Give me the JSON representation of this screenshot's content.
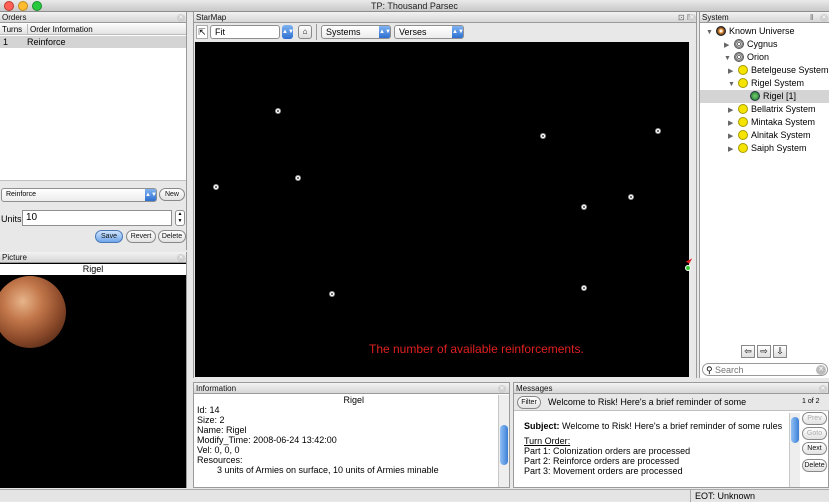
{
  "window": {
    "title": "TP: Thousand Parsec"
  },
  "orders": {
    "panel_title": "Orders",
    "columns": [
      "Turns",
      "Order Information"
    ],
    "rows": [
      {
        "turns": "1",
        "info": "Reinforce"
      }
    ],
    "order_type_selected": "Reinforce",
    "new_label": "New",
    "units_label": "Units",
    "units_value": "10",
    "save_label": "Save",
    "revert_label": "Revert",
    "delete_label": "Delete"
  },
  "picture": {
    "panel_title": "Picture",
    "caption": "Rigel"
  },
  "starmap": {
    "panel_title": "StarMap",
    "zoom_value": "Fit",
    "mode_value": "Systems",
    "overlay_value": "Verses",
    "annotation": "The number of available reinforcements."
  },
  "system": {
    "panel_title": "System",
    "tree": [
      {
        "label": "Known Universe",
        "icon": "universe-icon"
      },
      {
        "label": "Cygnus",
        "icon": "galaxy-icon"
      },
      {
        "label": "Orion",
        "icon": "galaxy-icon"
      },
      {
        "label": "Betelgeuse System",
        "icon": "sun-icon"
      },
      {
        "label": "Rigel System",
        "icon": "sun-icon"
      },
      {
        "label": "Rigel  [1]",
        "icon": "planet-icon"
      },
      {
        "label": "Bellatrix System",
        "icon": "sun-icon"
      },
      {
        "label": "Mintaka System",
        "icon": "sun-icon"
      },
      {
        "label": "Alnitak System",
        "icon": "sun-icon"
      },
      {
        "label": "Saiph System",
        "icon": "sun-icon"
      }
    ],
    "search_placeholder": "Search"
  },
  "information": {
    "panel_title": "Information",
    "heading": "Rigel",
    "lines": [
      "Id: 14",
      "Size: 2",
      "Name: Rigel",
      "Modify_Time: 2008-06-24 13:42:00",
      "Vel: 0, 0, 0",
      "Resources:"
    ],
    "resource_line": "3 units of Armies on surface, 10 units of Armies minable"
  },
  "messages": {
    "panel_title": "Messages",
    "filter_label": "Filter",
    "headline": "Welcome to Risk! Here's a brief reminder of some",
    "counter": "1 of 2",
    "subject_label": "Subject:",
    "subject_text": " Welcome to Risk! Here's a brief reminder of some rules",
    "turn_order_label": "Turn Order",
    "parts": [
      "Part 1: Colonization orders are processed",
      "Part 2: Reinforce orders are processed",
      "Part 3: Movement orders are processed"
    ],
    "prev_label": "Prev",
    "goto_label": "Goto",
    "next_label": "Next",
    "delete_label": "Delete"
  },
  "statusbar": {
    "text": "EOT: Unknown"
  },
  "colors": {
    "accent": "#3d7fd6",
    "annotation": "#e02020",
    "map_bg": "#000000"
  }
}
